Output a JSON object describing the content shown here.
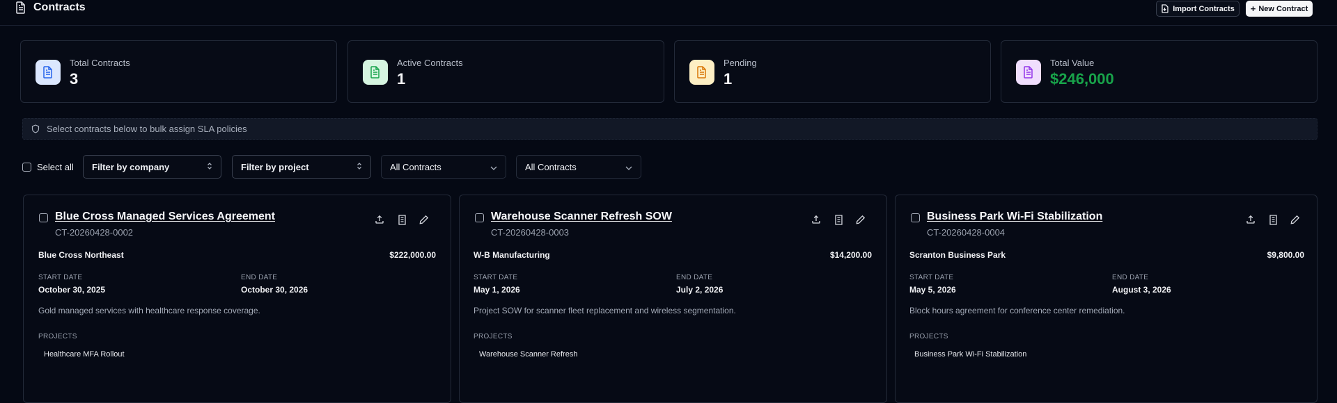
{
  "header": {
    "title": "Contracts",
    "import_label": "Import Contracts",
    "new_label": "New Contract"
  },
  "stats": [
    {
      "label": "Total Contracts",
      "value": "3",
      "icon": "document-icon",
      "color": "#2563eb"
    },
    {
      "label": "Active Contracts",
      "value": "1",
      "icon": "document-icon",
      "color": "#16a34a"
    },
    {
      "label": "Pending",
      "value": "1",
      "icon": "document-icon",
      "color": "#d97706"
    },
    {
      "label": "Total Value",
      "value": "$246,000",
      "icon": "document-icon",
      "color": "#9333ea"
    }
  ],
  "hint": "Select contracts below to bulk assign SLA policies",
  "filters": {
    "select_all": "Select all",
    "company": "Filter by company",
    "project": "Filter by project",
    "status1": "All Contracts",
    "status2": "All Contracts"
  },
  "labels": {
    "start": "START DATE",
    "end": "END DATE",
    "projects": "PROJECTS"
  },
  "contracts": [
    {
      "title": "Blue Cross Managed Services Agreement",
      "id": "CT-20260428-0002",
      "company": "Blue Cross Northeast",
      "amount": "$222,000.00",
      "start": "October 30, 2025",
      "end": "October 30, 2026",
      "description": "Gold managed services with healthcare response coverage.",
      "project": "Healthcare MFA Rollout"
    },
    {
      "title": "Warehouse Scanner Refresh SOW",
      "id": "CT-20260428-0003",
      "company": "W-B Manufacturing",
      "amount": "$14,200.00",
      "start": "May 1, 2026",
      "end": "July 2, 2026",
      "description": "Project SOW for scanner fleet replacement and wireless segmentation.",
      "project": "Warehouse Scanner Refresh"
    },
    {
      "title": "Business Park Wi-Fi Stabilization",
      "id": "CT-20260428-0004",
      "company": "Scranton Business Park",
      "amount": "$9,800.00",
      "start": "May 5, 2026",
      "end": "August 3, 2026",
      "description": "Block hours agreement for conference center remediation.",
      "project": "Business Park Wi-Fi Stabilization"
    }
  ]
}
